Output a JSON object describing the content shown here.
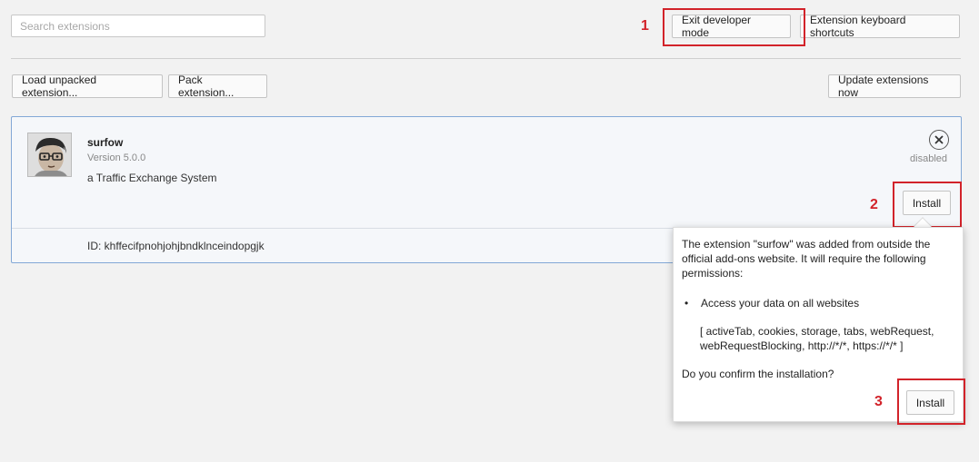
{
  "header": {
    "search_placeholder": "Search extensions",
    "exit_dev_mode_label": "Exit developer mode",
    "keyboard_shortcuts_label": "Extension keyboard shortcuts"
  },
  "toolbar": {
    "load_unpacked_label": "Load unpacked extension...",
    "pack_label": "Pack extension...",
    "update_label": "Update extensions now"
  },
  "extension": {
    "name": "surfow",
    "version": "Version 5.0.0",
    "description": "a Traffic Exchange System",
    "id": "ID: khffecifpnohjohjbndklnceindopgjk",
    "status": "disabled",
    "install_label": "Install"
  },
  "popup": {
    "message": "The extension \"surfow\" was added from outside the official add-ons website. It will require the following permissions:",
    "permission": "Access your data on all websites",
    "permission_detail": "[ activeTab, cookies, storage, tabs, webRequest, webRequestBlocking, http://*/*, https://*/* ]",
    "confirm_text": "Do you confirm the installation?",
    "install_label": "Install"
  },
  "annotations": {
    "one": "1",
    "two": "2",
    "three": "3",
    "color": "#d2232a"
  },
  "icons": {
    "close": "close-icon",
    "avatar": "extension-avatar-icon"
  }
}
